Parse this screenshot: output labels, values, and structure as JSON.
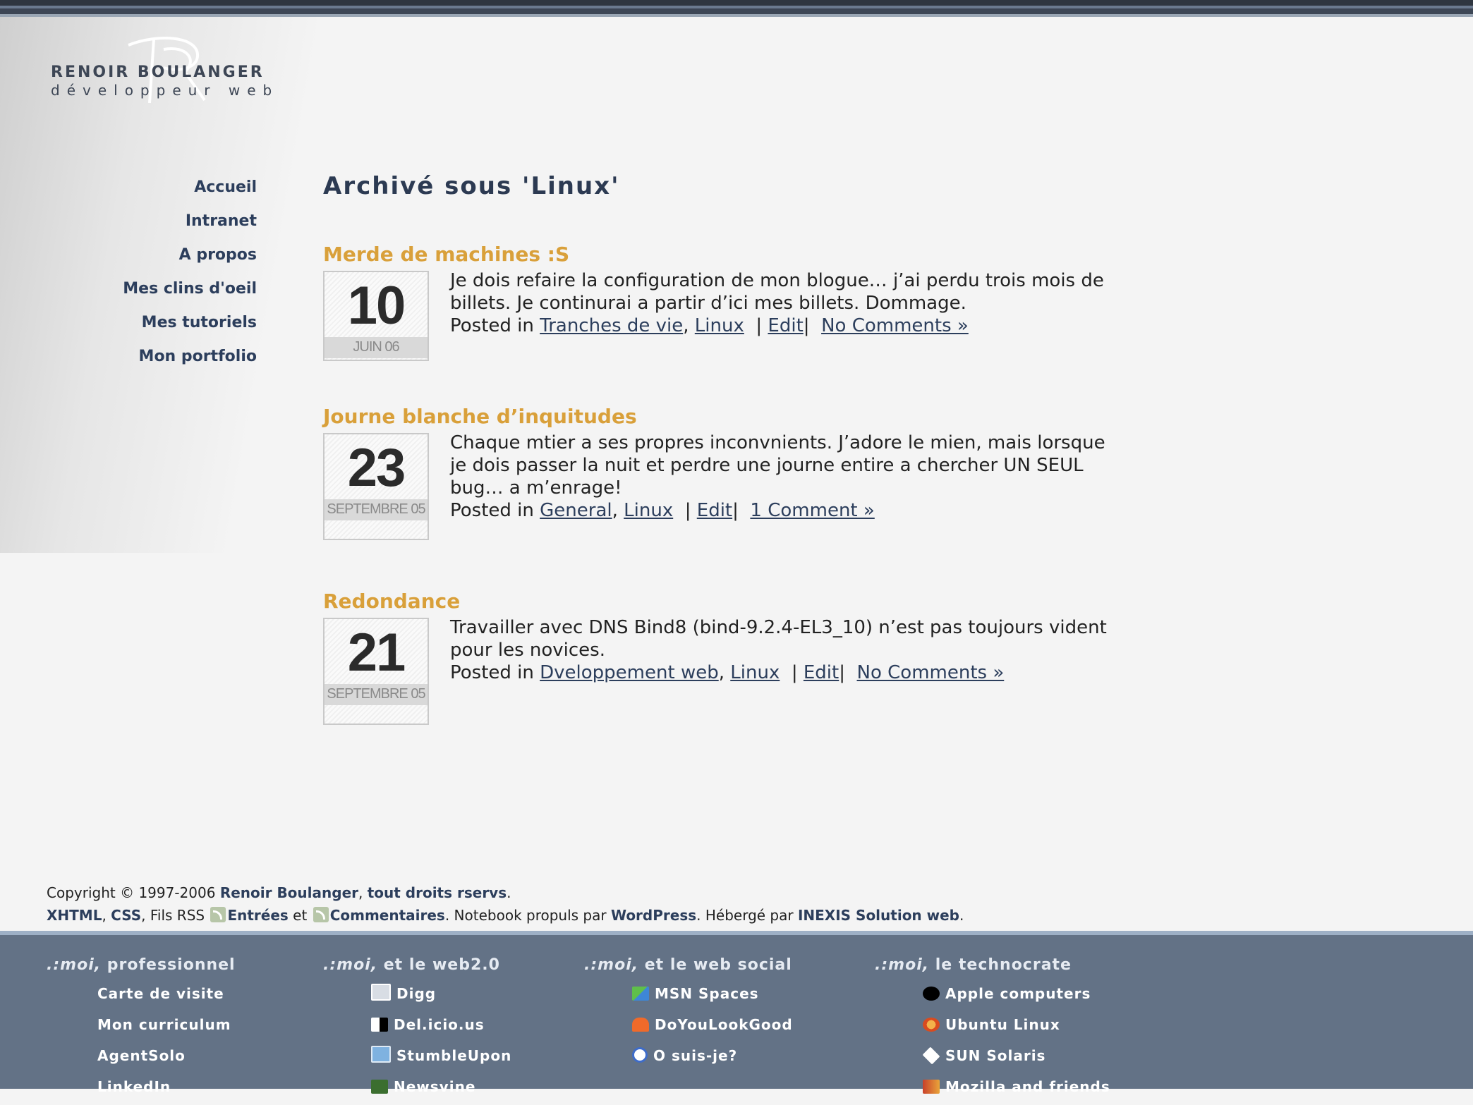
{
  "logo": {
    "name": "RENOIR BOULANGER",
    "sub": "développeur web"
  },
  "nav": [
    "Accueil",
    "Intranet",
    "A propos",
    "Mes clins d'oeil",
    "Mes tutoriels",
    "Mon portfolio"
  ],
  "page_title": "Archivé sous 'Linux'",
  "posts": [
    {
      "title": "Merde de machines :S",
      "day": "10",
      "month": "JUIN 06",
      "text": "Je dois refaire la configuration de mon blogue… j’ai perdu trois mois de billets. Je continurai a partir d’ici mes billets. Dommage.",
      "posted_in": "Posted in",
      "categories": [
        "Tranches de vie",
        "Linux"
      ],
      "edit": "Edit",
      "comments": "No Comments »"
    },
    {
      "title": "Journe blanche d’inquitudes",
      "day": "23",
      "month": "SEPTEMBRE 05",
      "text": "Chaque mtier a ses propres inconvnients. J’adore le mien, mais lorsque je dois passer la nuit et perdre une journe entire a chercher UN SEUL bug… a m’enrage!",
      "posted_in": "Posted in",
      "categories": [
        "General",
        "Linux"
      ],
      "edit": "Edit",
      "comments": "1 Comment »"
    },
    {
      "title": "Redondance",
      "day": "21",
      "month": "SEPTEMBRE 05",
      "text": "Travailler avec DNS Bind8 (bind-9.2.4-EL3_10) n’est pas toujours vident pour les novices.",
      "posted_in": "Posted in",
      "categories": [
        "Dveloppement web",
        "Linux"
      ],
      "edit": "Edit",
      "comments": "No Comments »"
    }
  ],
  "footer": {
    "copyright_prefix": "Copyright © 1997-2006",
    "author": "Renoir Boulanger",
    "rights": "tout droits rservs",
    "xhtml": "XHTML",
    "css": "CSS",
    "fils_rss": "Fils RSS",
    "entries": "Entrées",
    "et": "et",
    "comments": "Commentaires",
    "notebook": ". Notebook propuls par",
    "wordpress": "WordPress",
    "heberge": ". Hébergé par",
    "host": "INEXIS Solution web"
  },
  "bottom": [
    {
      "prefix": ".:moi,",
      "title": "professionnel",
      "items": [
        "Carte de visite",
        "Mon curriculum",
        "AgentSolo",
        "LinkedIn"
      ]
    },
    {
      "prefix": ".:moi,",
      "title": "et le web2.0",
      "items": [
        "Digg",
        "Del.icio.us",
        "StumbleUpon",
        "Newsvine"
      ],
      "icons": [
        "digg-icon",
        "delicious-icon",
        "stumbleupon-icon",
        "newsvine-icon"
      ]
    },
    {
      "prefix": ".:moi,",
      "title": "et le web social",
      "items": [
        "MSN Spaces",
        "DoYouLookGood",
        "O suis-je?"
      ],
      "icons": [
        "msn-spaces-icon",
        "doyoulookgood-icon",
        "google-maps-icon"
      ]
    },
    {
      "prefix": ".:moi,",
      "title": "le technocrate",
      "items": [
        "Apple computers",
        "Ubuntu Linux",
        "SUN Solaris",
        "Mozilla and friends"
      ],
      "icons": [
        "apple-icon",
        "ubuntu-icon",
        "sun-icon",
        "mozilla-icon"
      ]
    }
  ]
}
